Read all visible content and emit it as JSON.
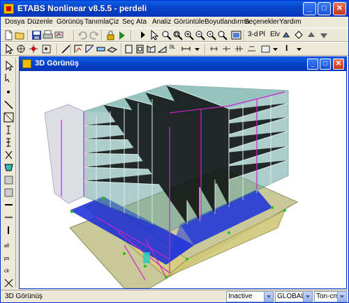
{
  "app": {
    "title": "ETABS Nonlinear v8.5.5  -  perdeli"
  },
  "menu": {
    "items": [
      "Dosya",
      "Düzenle",
      "Görünüş",
      "Tanımla",
      "Çiz",
      "Seç",
      "Ata",
      "Analiz",
      "Görüntüle",
      "Boyutlandırma",
      "Seçenekler",
      "Yardım"
    ]
  },
  "toolbar": {
    "view3d_label": "3-d",
    "plan_label": "Pl",
    "elev_label": "Elv"
  },
  "child_window": {
    "title": "3D Görünüş"
  },
  "status": {
    "text": "3D Görünüş",
    "analysis_state": "Inactive",
    "coord_system": "GLOBAL",
    "units": "Ton-cm"
  },
  "colors": {
    "titlebar": "#0842c9",
    "slab_blue": "#1428d8",
    "wall_yellow": "#d8d080",
    "frame_magenta": "#d020d0",
    "glass_teal": "#6aa6a0",
    "ground": "#c0c090"
  }
}
